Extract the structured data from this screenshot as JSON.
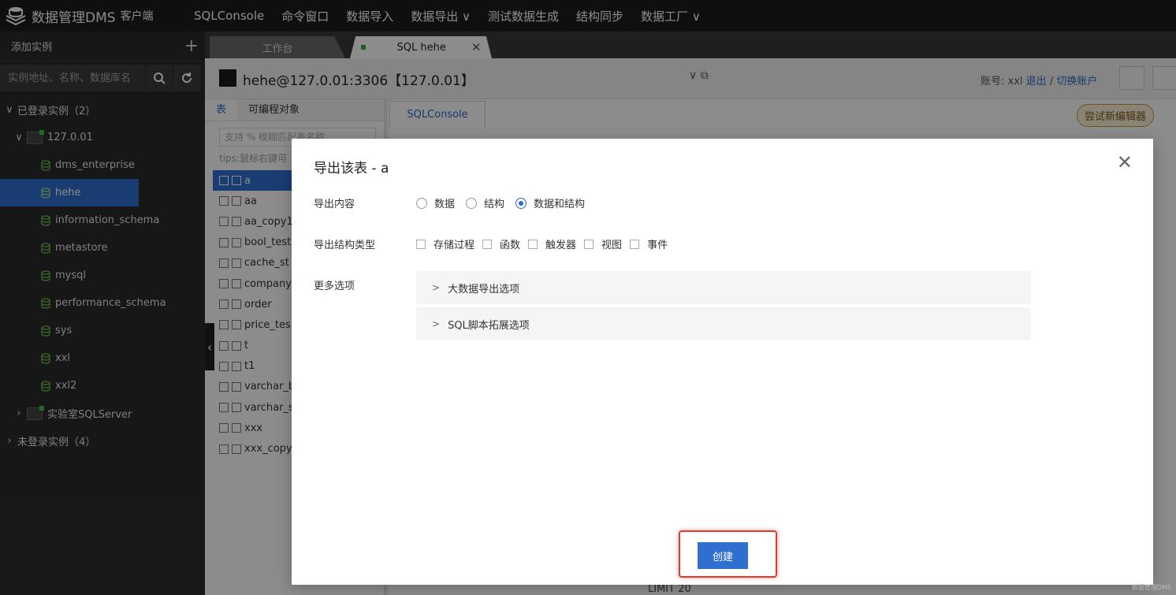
{
  "app": {
    "brand_name": "数据管理DMS",
    "brand_suffix": "客户端"
  },
  "topnav": [
    "SQLConsole",
    "命令窗口",
    "数据导入",
    "数据导出 ∨",
    "测试数据生成",
    "结构同步",
    "数据工厂 ∨"
  ],
  "sidebar": {
    "add_instance": "添加实例",
    "search_placeholder": "实例地址、名称、数据库名",
    "logged_group": "已登录实例（2）",
    "instance_name": "127.0.01",
    "databases": [
      "dms_enterprise",
      "hehe",
      "information_schema",
      "metastore",
      "mysql",
      "performance_schema",
      "sys",
      "xxl",
      "xxl2"
    ],
    "selected_db": "hehe",
    "other_instance": "实验室SQLServer",
    "not_logged_group": "未登录实例（4）"
  },
  "tabs": {
    "workbench": "工作台",
    "sql": "SQL hehe"
  },
  "connection": {
    "title": "hehe@127.0.01:3306【127.0.01】",
    "account_label": "账号: xxl",
    "logout": "退出",
    "separator": " / ",
    "switch": "切换账户"
  },
  "leftpanel": {
    "tab_table": "表",
    "tab_programmable": "可编程对象",
    "search_placeholder": "支持 % 模糊匹配表名称",
    "tips": "tips:鼠标右键可",
    "tables": [
      "a",
      "aa",
      "aa_copy1",
      "bool_test",
      "cache_st",
      "company",
      "order",
      "price_tes",
      "t",
      "t1",
      "varchar_b",
      "varchar_s",
      "xxx",
      "xxx_copy"
    ]
  },
  "main": {
    "sqlconsole_tab": "SQLConsole",
    "try_new_editor": "尝试新编辑器",
    "bottom_text": "LIMIT 20"
  },
  "dialog": {
    "title": "导出该表 - a",
    "export_content_label": "导出内容",
    "export_options": [
      "数据",
      "结构",
      "数据和结构"
    ],
    "selected_export": "数据和结构",
    "structure_type_label": "导出结构类型",
    "structure_types": [
      "存储过程",
      "函数",
      "触发器",
      "视图",
      "事件"
    ],
    "more_options_label": "更多选项",
    "panels": [
      "大数据导出选项",
      "SQL脚本拓展选项"
    ],
    "create_button": "创建"
  },
  "watermark": "数据管理DMS",
  "colors": {
    "accent": "#2f6fd0",
    "highlight": "#e23a2a",
    "topbar": "#1d1d1d",
    "sidebar": "#2b2b2b"
  }
}
